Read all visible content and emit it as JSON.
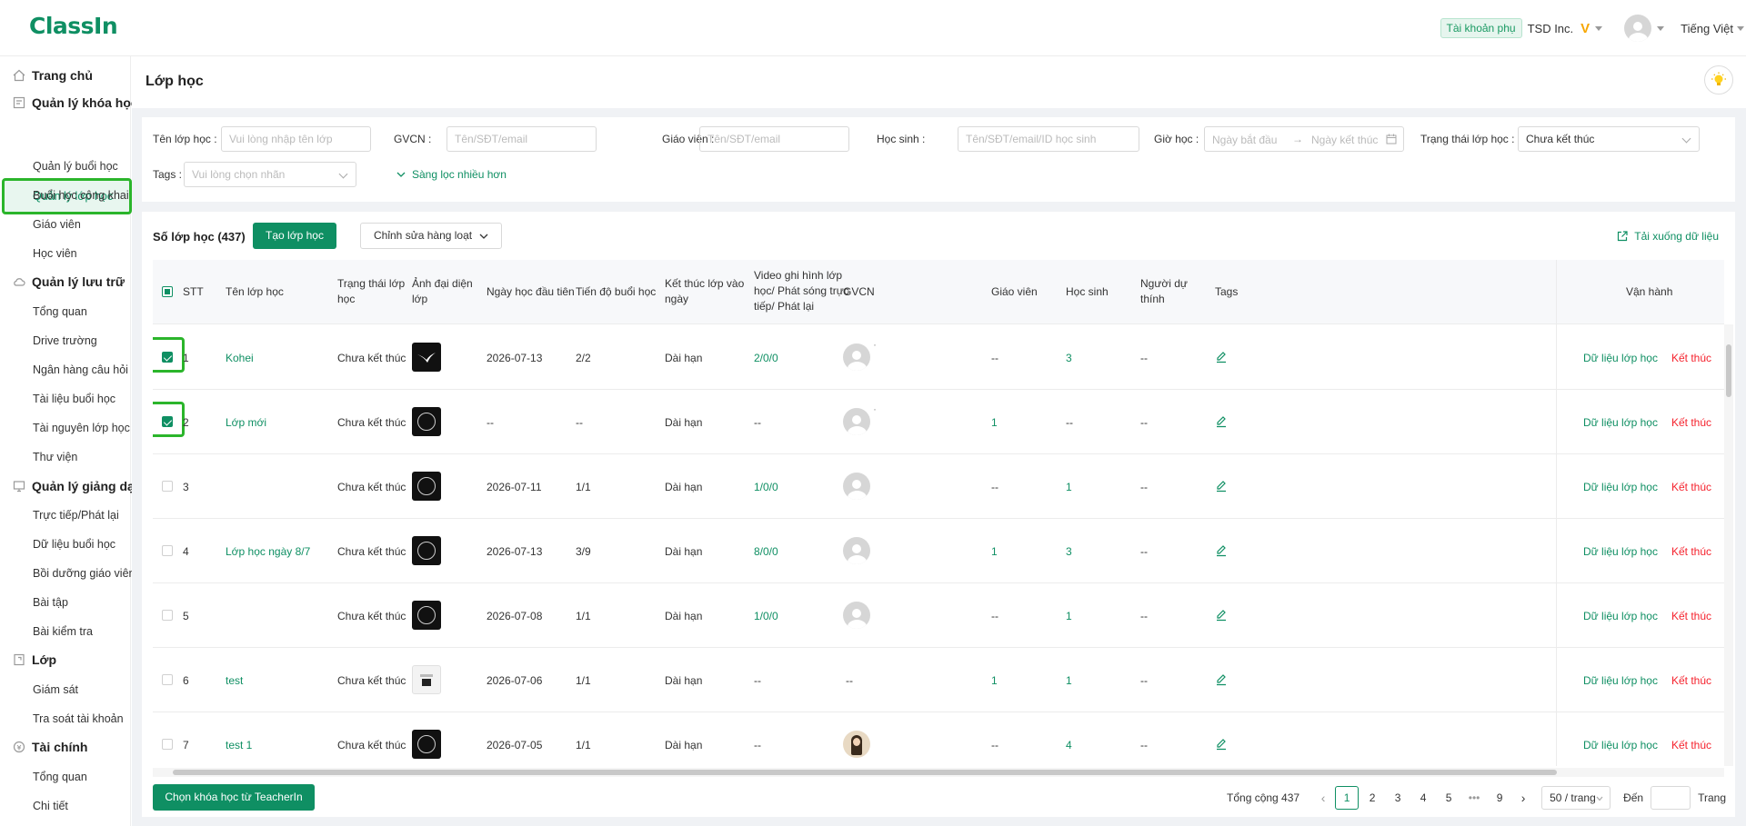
{
  "app": {
    "logo": "ClassIn",
    "sub_account": "Tài khoản phụ",
    "org": "TSD Inc.",
    "vip": "V",
    "language": "Tiếng Việt"
  },
  "sidebar": {
    "home": "Trang chủ",
    "course_mgmt": "Quản lý khóa học",
    "class_mgmt_active": "Quản lý lớp học",
    "items_course": [
      "Quản lý buổi học",
      "Buổi học công khai",
      "Giáo viên",
      "Học viên"
    ],
    "storage": "Quản lý lưu trữ",
    "items_storage": [
      "Tổng quan",
      "Drive trường",
      "Ngân hàng câu hỏi",
      "Tài liệu buổi học",
      "Tài nguyên lớp học",
      "Thư viện"
    ],
    "teaching": "Quản lý giảng dạy",
    "items_teaching": [
      "Trực tiếp/Phát lại",
      "Dữ liệu buổi học",
      "Bồi dưỡng giáo viên",
      "Bài tập",
      "Bài kiểm tra"
    ],
    "class_group": "Lớp",
    "items_class": [
      "Giám sát",
      "Tra soát tài khoản"
    ],
    "finance": "Tài chính",
    "items_finance": [
      "Tổng quan",
      "Chi tiết"
    ]
  },
  "page": {
    "title": "Lớp học"
  },
  "filters": {
    "class_name_label": "Tên lớp học :",
    "class_name_ph": "Vui lòng nhập tên lớp",
    "gvcn_label": "GVCN :",
    "gvcn_ph": "Tên/SĐT/email",
    "teacher_label": "Giáo viên :",
    "teacher_ph": "Tên/SĐT/email",
    "student_label": "Học sinh :",
    "student_ph": "Tên/SĐT/email/ID học sinh",
    "time_label": "Giờ học :",
    "start_ph": "Ngày bắt đầu",
    "arrow": "→",
    "end_ph": "Ngày kết thúc",
    "status_label": "Trạng thái lớp học :",
    "status_value": "Chưa kết thúc",
    "tags_label": "Tags :",
    "tags_ph": "Vui lòng chọn nhãn",
    "more": "Sàng lọc nhiều hơn"
  },
  "toolbar": {
    "count": "Số lớp học (437)",
    "create": "Tạo lớp học",
    "bulk_edit": "Chỉnh sửa hàng loạt",
    "download": "Tải xuống dữ liệu"
  },
  "table": {
    "headers": {
      "stt": "STT",
      "name": "Tên lớp học",
      "status": "Trạng thái lớp học",
      "avatar": "Ảnh đại diện lớp",
      "first_date": "Ngày học đầu tiên",
      "progress": "Tiến độ buổi học",
      "end": "Kết thúc lớp vào ngày",
      "video": "Video ghi hình lớp học/ Phát sóng trực tiếp/ Phát lại",
      "gvcn": "GVCN",
      "teacher": "Giáo viên",
      "student": "Học sinh",
      "auditor": "Người dự thính",
      "tags": "Tags",
      "ops": "Vận hành"
    },
    "rows": [
      {
        "stt": "1",
        "name": "Kohei",
        "status": "Chưa kết thúc",
        "thumb": "bird",
        "first_date": "2026-07-13",
        "progress": "2/2",
        "end": "Dài hạn",
        "video": "2/0/0",
        "gvcn": "avatar",
        "gvcn_tick": "·",
        "teacher": "--",
        "student": "3",
        "auditor": "--",
        "checked": true,
        "op_data": "Dữ liệu lớp học",
        "op_end": "Kết thúc"
      },
      {
        "stt": "2",
        "name": "Lớp mới",
        "status": "Chưa kết thúc",
        "thumb": "logo",
        "first_date": "--",
        "progress": "--",
        "end": "Dài hạn",
        "video": "--",
        "gvcn": "avatar",
        "gvcn_tick": "·",
        "teacher": "1",
        "student": "--",
        "auditor": "--",
        "checked": true,
        "op_data": "Dữ liệu lớp học",
        "op_end": "Kết thúc"
      },
      {
        "stt": "3",
        "name": "",
        "status": "Chưa kết thúc",
        "thumb": "logo",
        "first_date": "2026-07-11",
        "progress": "1/1",
        "end": "Dài hạn",
        "video": "1/0/0",
        "gvcn": "avatar",
        "gvcn_tick": "",
        "teacher": "--",
        "student": "1",
        "auditor": "--",
        "checked": false,
        "op_data": "Dữ liệu lớp học",
        "op_end": "Kết thúc"
      },
      {
        "stt": "4",
        "name": "Lớp học ngày 8/7",
        "status": "Chưa kết thúc",
        "thumb": "logo",
        "first_date": "2026-07-13",
        "progress": "3/9",
        "end": "Dài hạn",
        "video": "8/0/0",
        "gvcn": "avatar",
        "gvcn_tick": "",
        "teacher": "1",
        "student": "3",
        "auditor": "--",
        "checked": false,
        "op_data": "Dữ liệu lớp học",
        "op_end": "Kết thúc"
      },
      {
        "stt": "5",
        "name": "",
        "status": "Chưa kết thúc",
        "thumb": "logo",
        "first_date": "2026-07-08",
        "progress": "1/1",
        "end": "Dài hạn",
        "video": "1/0/0",
        "gvcn": "avatar",
        "gvcn_tick": "",
        "teacher": "--",
        "student": "1",
        "auditor": "--",
        "checked": false,
        "op_data": "Dữ liệu lớp học",
        "op_end": "Kết thúc"
      },
      {
        "stt": "6",
        "name": "test",
        "status": "Chưa kết thúc",
        "thumb": "light",
        "first_date": "2026-07-06",
        "progress": "1/1",
        "end": "Dài hạn",
        "video": "--",
        "gvcn": "--",
        "gvcn_tick": "",
        "teacher": "1",
        "student": "1",
        "auditor": "--",
        "checked": false,
        "op_data": "Dữ liệu lớp học",
        "op_end": "Kết thúc"
      },
      {
        "stt": "7",
        "name": "test 1",
        "status": "Chưa kết thúc",
        "thumb": "logo",
        "first_date": "2026-07-05",
        "progress": "1/1",
        "end": "Dài hạn",
        "video": "--",
        "gvcn": "photo",
        "gvcn_tick": "",
        "teacher": "--",
        "student": "4",
        "auditor": "--",
        "checked": false,
        "op_data": "Dữ liệu lớp học",
        "op_end": "Kết thúc"
      }
    ]
  },
  "footer": {
    "teacherin": "Chọn khóa học từ TeacherIn"
  },
  "pagination": {
    "total": "Tổng cộng 437",
    "pages": [
      "1",
      "2",
      "3",
      "4",
      "5",
      "•••",
      "9"
    ],
    "active": "1",
    "size": "50 / trang",
    "goto": "Đến",
    "page_suffix": "Trang"
  },
  "colors": {
    "accent": "#0f8f63",
    "danger": "#f5222d",
    "highlight": "#2bb52b"
  }
}
